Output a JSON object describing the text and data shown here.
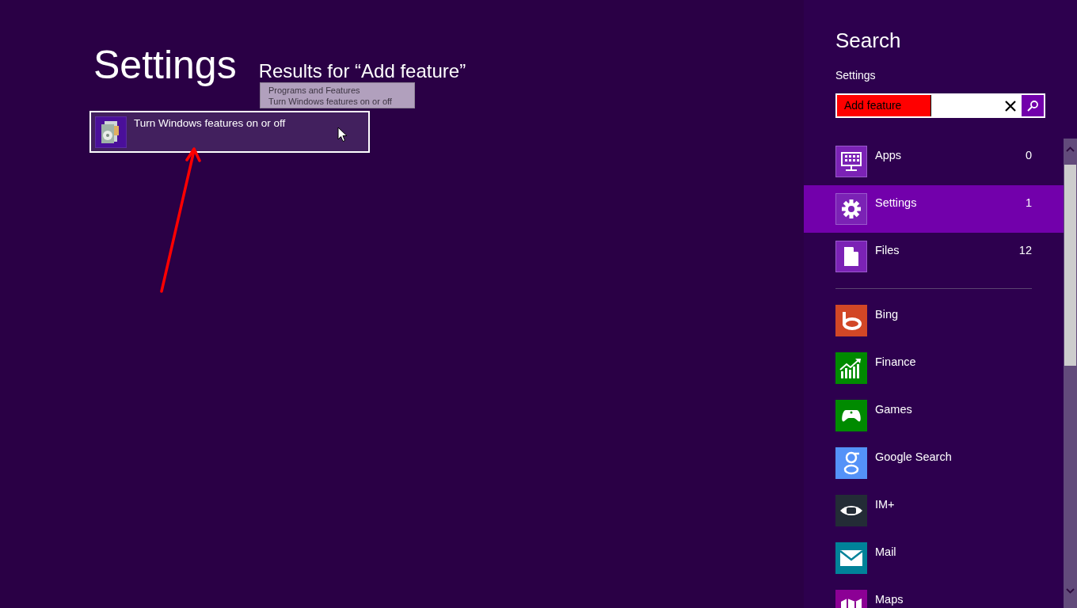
{
  "page": {
    "title": "Settings",
    "results_heading": "Results for “Add feature”"
  },
  "results": [
    {
      "label": "Turn Windows features on or off",
      "selected": true
    }
  ],
  "tooltip": {
    "title": "Programs and Features",
    "description": "Turn Windows features on or off"
  },
  "search_pane": {
    "title": "Search",
    "scope": "Settings",
    "query": "Add feature",
    "categories": [
      {
        "label": "Apps",
        "count": "0",
        "selected": false
      },
      {
        "label": "Settings",
        "count": "1",
        "selected": true
      },
      {
        "label": "Files",
        "count": "12",
        "selected": false
      }
    ],
    "apps": [
      {
        "label": "Bing",
        "color": "#d24726"
      },
      {
        "label": "Finance",
        "color": "#008a00"
      },
      {
        "label": "Games",
        "color": "#008a00"
      },
      {
        "label": "Google Search",
        "color": "#5492f8"
      },
      {
        "label": "IM+",
        "color": "#232c36"
      },
      {
        "label": "Mail",
        "color": "#008299"
      },
      {
        "label": "Maps",
        "color": "#8c0095"
      }
    ]
  }
}
